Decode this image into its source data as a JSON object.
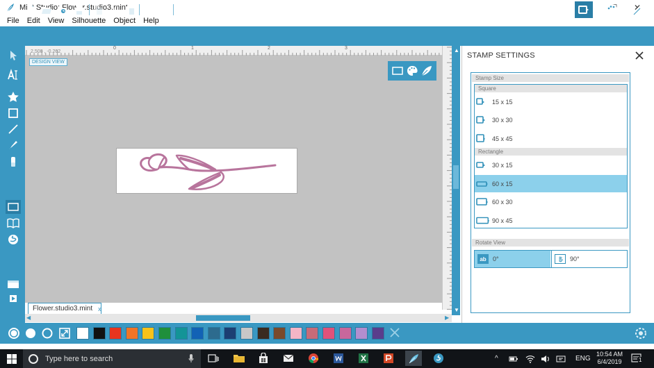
{
  "window": {
    "title": "Mint Studio: Flower.studio3.mint",
    "controls": {
      "minimize": "—",
      "maximize": "☐",
      "close": "✕"
    }
  },
  "menu": [
    "File",
    "Edit",
    "View",
    "Silhouette",
    "Object",
    "Help"
  ],
  "toolbar": {
    "left_icons": [
      "new-file-icon",
      "open-folder-icon",
      "open-recent-icon",
      "print-icon",
      "copy-icon",
      "cut-icon",
      "paste-icon",
      "undo-icon",
      "redo-icon",
      "zoom-in-icon",
      "zoom-out-icon",
      "zoom-select-icon",
      "pan-icon",
      "zoom-fit-icon",
      "fit-page-icon"
    ],
    "right_icons": [
      "line-style-icon",
      "text-style-icon",
      "trace-icon",
      "crop-icon",
      "offset-icon",
      "stamp-settings-icon",
      "color-icon",
      "sketch-icon"
    ],
    "active_right": "stamp-settings-icon"
  },
  "ruler": {
    "coords": "2.508 , -0.262",
    "labels": [
      "0",
      "1",
      "2",
      "3"
    ]
  },
  "canvas": {
    "view_label": "DESIGN VIEW",
    "stroke_color": "#b8749c"
  },
  "document_tab": {
    "name": "Flower.studio3.mint",
    "close": "x"
  },
  "stamp_settings": {
    "title": "STAMP SETTINGS",
    "stamp_size_label": "Stamp Size",
    "square_label": "Square",
    "square_sizes": [
      "15 x 15",
      "30 x 30",
      "45 x 45"
    ],
    "rectangle_label": "Rectangle",
    "rectangle_sizes": [
      "30 x 15",
      "60 x 15",
      "60 x 30",
      "90 x 45"
    ],
    "selected_size": "60 x 15",
    "rotate_view_label": "Rotate View",
    "rotations": [
      "0°",
      "90°"
    ],
    "rotate_icon_labels": [
      "ab",
      "ab"
    ],
    "selected_rotation": "0°"
  },
  "colors": {
    "accent": "#3a98c2",
    "swatches": [
      "#ffffff",
      "#111111",
      "#e8351e",
      "#f07426",
      "#f8c21a",
      "#1f8f3b",
      "#139497",
      "#1262b5",
      "#2d6b8e",
      "#1c3f73",
      "#c7c7c7",
      "#3a2b20",
      "#7a4a2b",
      "#f4b5c6",
      "#c86b78",
      "#e0527a",
      "#c8679c",
      "#b28ecf",
      "#5a3d8c"
    ]
  },
  "taskbar": {
    "search_placeholder": "Type here to search",
    "language": "ENG",
    "time": "10:54 AM",
    "date": "6/4/2019",
    "notifications": "1"
  }
}
